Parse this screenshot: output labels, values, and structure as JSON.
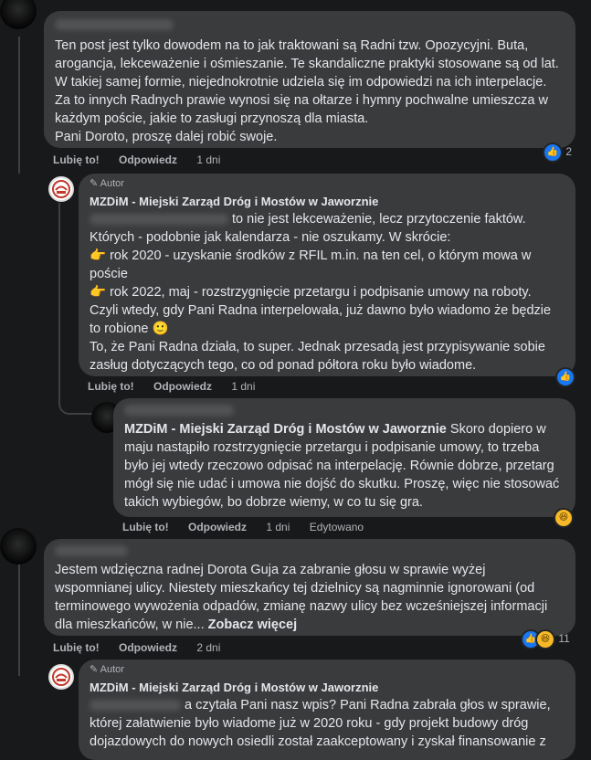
{
  "comment1": {
    "body": "Ten post jest tylko dowodem na to jak traktowani są Radni tzw. Opozycyjni. Buta, arogancja, lekceważenie i ośmieszanie. Te skandaliczne praktyki stosowane są od lat. W takiej samej formie, niejednokrotnie udziela się im odpowiedzi na ich interpelacje. Za to innych Radnych prawie wynosi się na ołtarze i hymny pochwalne umieszcza w każdym poście, jakie to zasługi przynoszą dla miasta.\nPani Doroto, proszę dalej robić swoje.",
    "reaction_count": "2",
    "like": "Lubię to!",
    "reply": "Odpowiedz",
    "time": "1 dni"
  },
  "reply1": {
    "author_tag": "Autor",
    "author": "MZDiM - Miejski Zarząd Dróg i Mostów w Jaworznie",
    "line1": "to nie jest lekceważenie, lecz przytoczenie faktów.",
    "body": "Których - podobnie jak kalendarza - nie oszukamy. W skrócie:\n👉 rok 2020 - uzyskanie środków z RFIL m.in. na ten cel, o którym mowa w poście\n👉 rok 2022, maj - rozstrzygnięcie przetargu i podpisanie umowy na roboty.\nCzyli wtedy, gdy Pani Radna interpelowała, już dawno było wiadomo że będzie to robione 🙂\nTo, że Pani Radna działa, to super. Jednak przesadą jest przypisywanie sobie zasług dotyczących tego, co od ponad półtora roku było wiadome.",
    "like": "Lubię to!",
    "reply": "Odpowiedz",
    "time": "1 dni"
  },
  "reply2": {
    "mention": "MZDiM - Miejski Zarząd Dróg i Mostów w Jaworznie",
    "body": " Skoro dopiero w maju nastąpiło rozstrzygnięcie przetargu i podpisanie umowy, to trzeba było jej wtedy rzeczowo odpisać na interpelację. Równie dobrze, przetarg mógł się nie udać i umowa nie dojść do skutku. Proszę, więc nie stosować takich wybiegów, bo dobrze wiemy, w co tu się gra.",
    "like": "Lubię to!",
    "reply": "Odpowiedz",
    "time": "1 dni",
    "edited": "Edytowano"
  },
  "comment2": {
    "body": "Jestem wdzięczna radnej Dorota Guja za zabranie głosu w sprawie wyżej wspomnianej ulicy. Niestety mieszkańcy tej dzielnicy są nagminnie ignorowani (od terminowego wywożenia odpadów, zmianę nazwy ulicy bez wcześniejszej informacji dla mieszkańców, w nie... ",
    "see_more": "Zobacz więcej",
    "reaction_count": "11",
    "like": "Lubię to!",
    "reply": "Odpowiedz",
    "time": "2 dni"
  },
  "reply3": {
    "author_tag": "Autor",
    "author": "MZDiM - Miejski Zarząd Dróg i Mostów w Jaworznie",
    "line1": "a czytała Pani nasz wpis? Pani Radna zabrała głos w sprawie,",
    "body": "której załatwienie było wiadome już w 2020 roku - gdy projekt budowy dróg dojazdowych do nowych osiedli został zaakceptowany i zyskał finansowanie z"
  },
  "icons": {
    "like": "thumbs-up-icon",
    "haha": "laughing-face-icon",
    "pencil": "pencil-icon"
  },
  "colors": {
    "background": "#18191a",
    "bubble": "#3a3b3c",
    "like_blue": "#1877f2",
    "secondary_text": "#b0b3b8"
  }
}
